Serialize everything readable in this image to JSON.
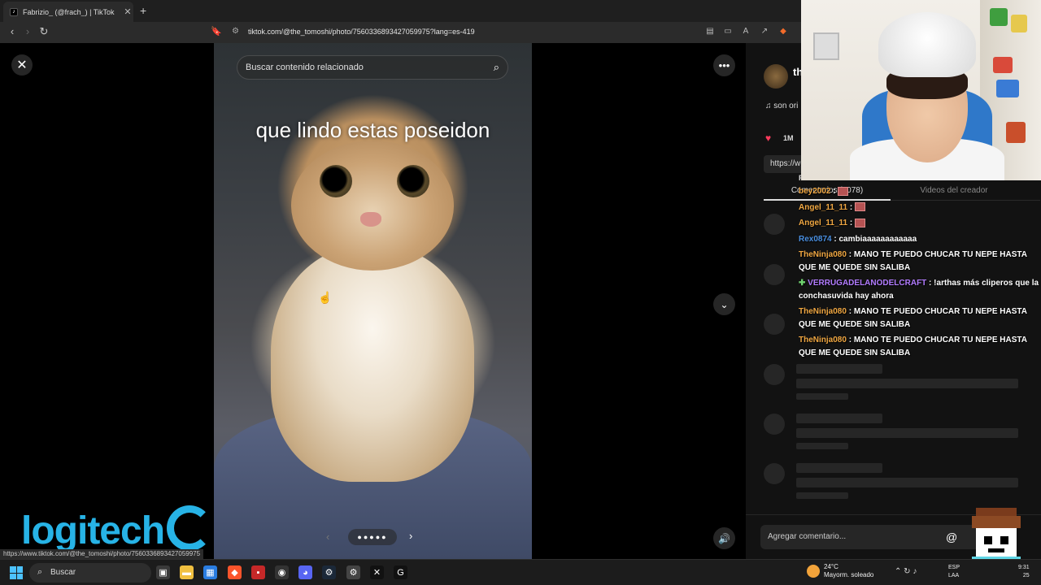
{
  "browser": {
    "tab_title": "Fabrizio_ (@frach_) | TikTok",
    "tab_close": "✕",
    "new_tab": "+",
    "url": "tiktok.com/@the_tomoshi/photo/7560336893427059975?lang=es-419"
  },
  "viewer": {
    "search_placeholder": "Buscar contenido relacionado",
    "caption": "que lindo estas poseidon",
    "close": "✕",
    "more": "•••",
    "down": "⌄",
    "volume": "🔊",
    "dots": "●●●●●",
    "prev": "‹",
    "next": "›"
  },
  "panel": {
    "username": "th",
    "music": "♫  son ori",
    "likes": "1M",
    "link": "https://w",
    "tabs": {
      "comments": "Comentarios (2078)",
      "creator_videos": "Videos del creador"
    },
    "comment_placeholder": "Agregar comentario...",
    "at": "@"
  },
  "chat": {
    "header": "RECOMIENDAS",
    "messages": [
      {
        "user": "bey2002",
        "color": "#f0a742",
        "text": "",
        "emote": true
      },
      {
        "user": "Angel_11_11",
        "color": "#f0a742",
        "text": "",
        "emote": true
      },
      {
        "user": "Angel_11_11",
        "color": "#f0a742",
        "text": "",
        "emote": true
      },
      {
        "user": "Rex0874",
        "color": "#4a8fe0",
        "text": "cambiaaaaaaaaaaaa",
        "emote": false
      },
      {
        "user": "TheNinja080",
        "color": "#f0a742",
        "text": "MANO TE PUEDO CHUCAR TU NEPE HASTA QUE ME QUEDE SIN SALIBA",
        "emote": false
      },
      {
        "user": "VERRUGADELANODELCRAFT",
        "color": "#b27cff",
        "text": "!arthas más cliperos que la conchasuvida hay ahora",
        "emote": false,
        "badge": "✚"
      },
      {
        "user": "TheNinja080",
        "color": "#f0a742",
        "text": "MANO TE PUEDO CHUCAR TU NEPE HASTA QUE ME QUEDE SIN SALIBA",
        "emote": false
      },
      {
        "user": "TheNinja080",
        "color": "#f0a742",
        "text": "MANO TE PUEDO CHUCAR TU NEPE HASTA QUE ME QUEDE SIN SALIBA",
        "emote": false
      }
    ]
  },
  "overlay": {
    "brand": "logitech",
    "status_url": "https://www.tiktok.com/@the_tomoshi/photo/7560336893427059975"
  },
  "taskbar": {
    "search": "Buscar",
    "weather_temp": "24°C",
    "weather_desc": "Mayorm. soleado",
    "lang_1": "ESP",
    "lang_2": "LAA",
    "time": "9:31",
    "date": "25"
  }
}
